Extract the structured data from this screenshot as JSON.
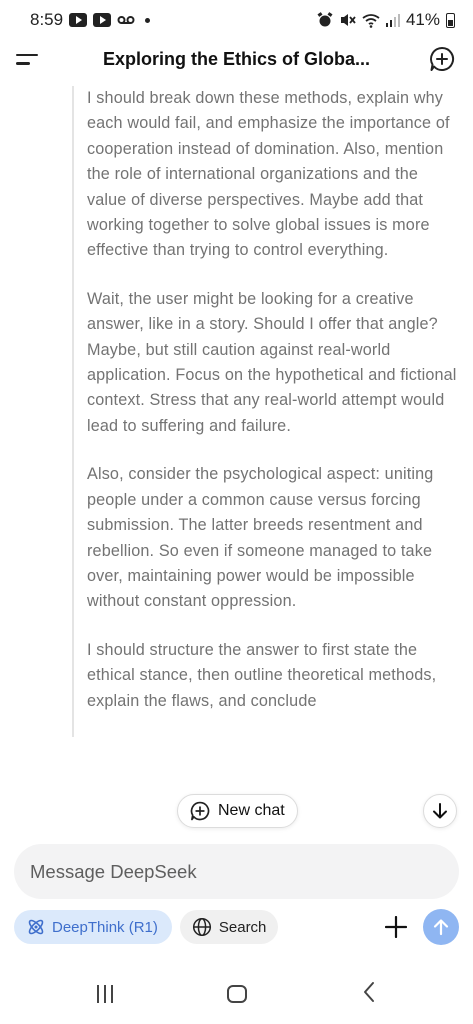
{
  "status_bar": {
    "time": "8:59",
    "battery": "41%"
  },
  "header": {
    "title": "Exploring the Ethics of Globa..."
  },
  "thinking": {
    "paragraphs": [
      "I should break down these methods, explain why each would fail, and emphasize the importance of cooperation instead of domination. Also, mention the role of international organizations and the value of diverse perspectives. Maybe add that working together to solve global issues is more effective than trying to control everything.",
      "Wait, the user might be looking for a creative answer, like in a story. Should I offer that angle? Maybe, but still caution against real-world application. Focus on the hypothetical and fictional context. Stress that any real-world attempt would lead to suffering and failure.",
      "Also, consider the psychological aspect: uniting people under a common cause versus forcing submission. The latter breeds resentment and rebellion. So even if someone managed to take over, maintaining power would be impossible without constant oppression.",
      "I should structure the answer to first state the ethical stance, then outline theoretical methods, explain the flaws, and conclude"
    ]
  },
  "new_chat_pill": {
    "label": "New chat"
  },
  "input": {
    "placeholder": "Message DeepSeek"
  },
  "controls": {
    "deepthink_label": "DeepThink (R1)",
    "search_label": "Search"
  },
  "colors": {
    "accent": "#3f6fcc",
    "deepthink_bg": "#dbe9fb",
    "send_bg": "#8fb6f2",
    "thinking_text": "#737373"
  }
}
